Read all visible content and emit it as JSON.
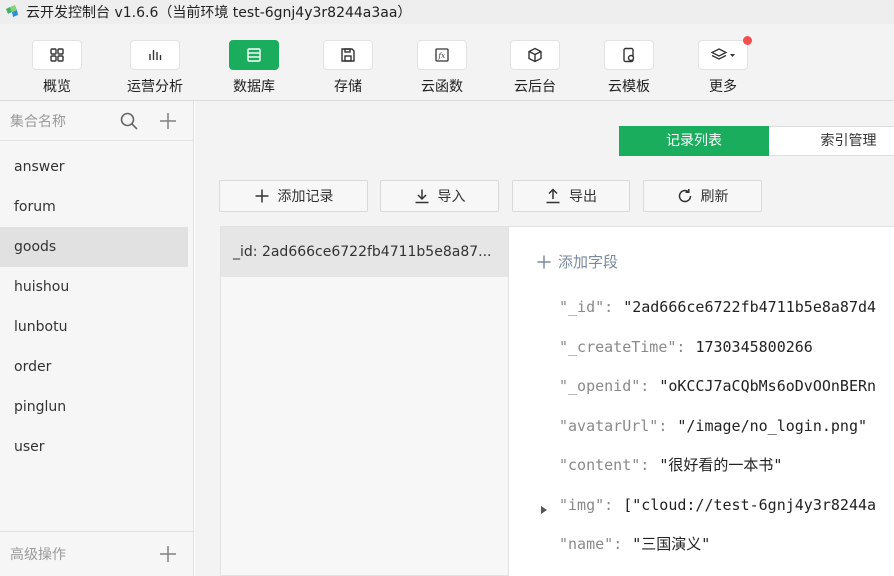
{
  "window": {
    "title": "云开发控制台 v1.6.6（当前环境 test-6gnj4y3r8244a3aa）"
  },
  "toolbar": {
    "items": [
      {
        "label": "概览",
        "icon": "grid-icon"
      },
      {
        "label": "运营分析",
        "icon": "bar-chart-icon"
      },
      {
        "label": "数据库",
        "icon": "database-icon",
        "active": true
      },
      {
        "label": "存储",
        "icon": "save-icon"
      },
      {
        "label": "云函数",
        "icon": "function-icon"
      },
      {
        "label": "云后台",
        "icon": "cube-icon"
      },
      {
        "label": "云模板",
        "icon": "phone-template-icon"
      },
      {
        "label": "更多",
        "icon": "layers-icon"
      }
    ],
    "accent": "#1aad5e"
  },
  "sidebar": {
    "header_label": "集合名称",
    "collections": [
      "answer",
      "forum",
      "goods",
      "huishou",
      "lunbotu",
      "order",
      "pinglun",
      "user"
    ],
    "selected": "goods",
    "footer_label": "高级操作"
  },
  "main": {
    "tabs": [
      "记录列表",
      "索引管理"
    ],
    "actions": {
      "add": "添加记录",
      "import": "导入",
      "export": "导出",
      "refresh": "刷新"
    },
    "record_row": "_id: 2ad666ce6722fb4711b5e8a87...",
    "add_field": "添加字段",
    "fields": [
      {
        "key": "\"_id\"",
        "value": "\"2ad666ce6722fb4711b5e8a87d4"
      },
      {
        "key": "\"_createTime\"",
        "value": "1730345800266"
      },
      {
        "key": "\"_openid\"",
        "value": "\"oKCCJ7aCQbMs6oDvOOnBERn"
      },
      {
        "key": "\"avatarUrl\"",
        "value": "\"/image/no_login.png\""
      },
      {
        "key": "\"content\"",
        "value": "\"很好看的一本书\""
      },
      {
        "key": "\"img\"",
        "value": "[\"cloud://test-6gnj4y3r8244a"
      },
      {
        "key": "\"name\"",
        "value": "\"三国演义\""
      }
    ]
  }
}
